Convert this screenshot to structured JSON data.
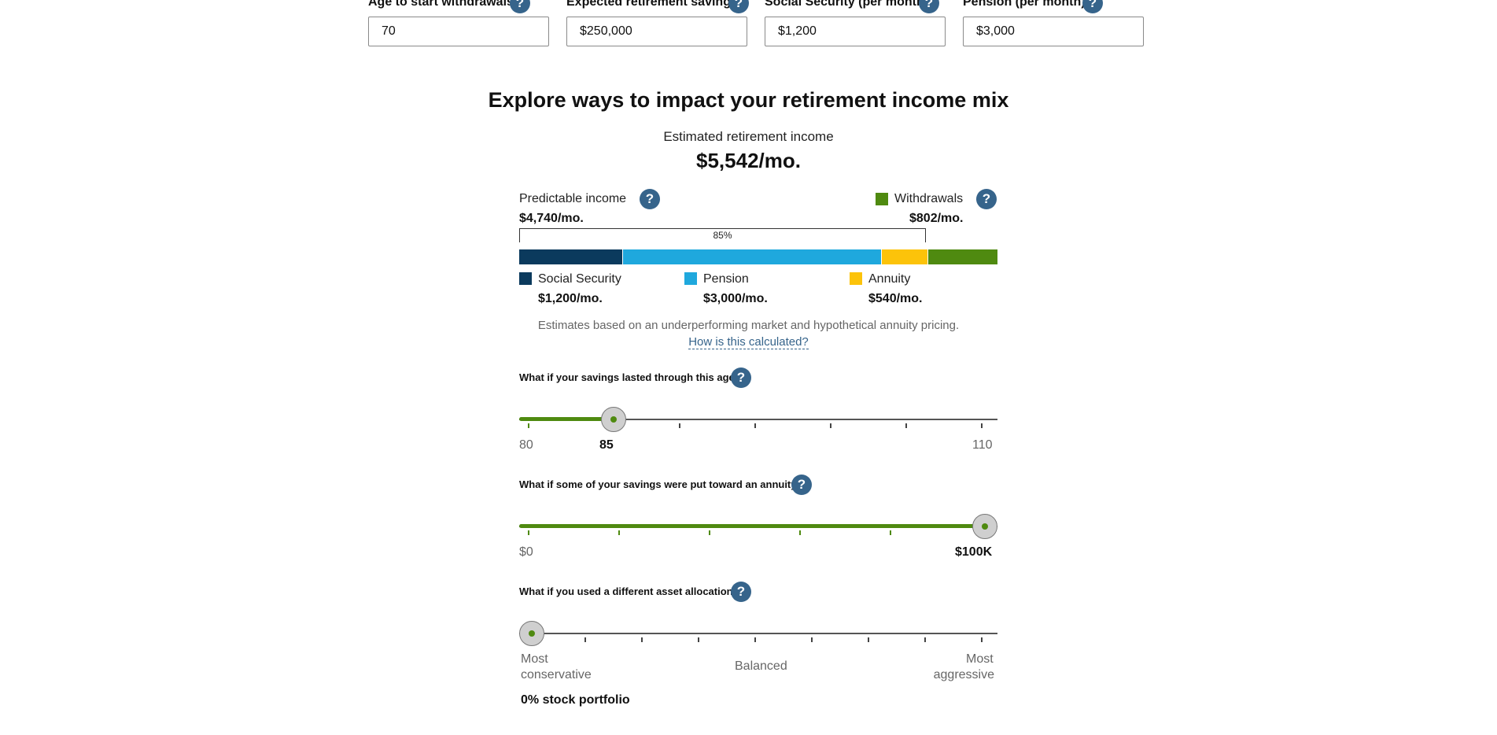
{
  "inputs": [
    {
      "label": "Age to start withdrawals",
      "value": "70"
    },
    {
      "label": "Expected retirement savings",
      "value": "$250,000"
    },
    {
      "label": "Social Security (per month)",
      "value": "$1,200"
    },
    {
      "label": "Pension (per month)",
      "value": "$3,000"
    }
  ],
  "help_glyph": "?",
  "heading": "Explore ways to impact your retirement income mix",
  "estimate": {
    "label": "Estimated retirement income",
    "value": "$5,542/mo."
  },
  "predictable": {
    "label": "Predictable income",
    "value": "$4,740/mo.",
    "percent": "85%"
  },
  "withdrawals": {
    "label": "Withdrawals",
    "value": "$802/mo.",
    "color": "#4f8a10"
  },
  "income_bar": {
    "segments": [
      {
        "name": "Social Security",
        "amount": 1200,
        "color": "#0b3a5d"
      },
      {
        "name": "Pension",
        "amount": 3000,
        "color": "#1fa8dd"
      },
      {
        "name": "Annuity",
        "amount": 540,
        "color": "#fcc30a"
      },
      {
        "name": "Withdrawals",
        "amount": 802,
        "color": "#4f8a10"
      }
    ]
  },
  "legend": [
    {
      "label": "Social Security",
      "value": "$1,200/mo.",
      "color": "#0b3a5d"
    },
    {
      "label": "Pension",
      "value": "$3,000/mo.",
      "color": "#1fa8dd"
    },
    {
      "label": "Annuity",
      "value": "$540/mo.",
      "color": "#fcc30a"
    }
  ],
  "disclaimer": "Estimates based on an underperforming market and hypothetical annuity pricing.",
  "calc_link": "How is this calculated?",
  "sliders": {
    "age": {
      "question": "What if your savings lasted through this age?",
      "min_label": "80",
      "value_label": "85",
      "max_label": "110",
      "fraction": 0.18
    },
    "annuity": {
      "question": "What if some of your savings were put toward an annuity?",
      "min_label": "$0",
      "value_label": "$100K",
      "fraction": 1.0
    },
    "allocation": {
      "question": "What if you used a different asset allocation?",
      "min_label_1": "Most",
      "min_label_2": "conservative",
      "mid_label": "Balanced",
      "max_label_1": "Most",
      "max_label_2": "aggressive",
      "fraction": 0.0,
      "result": "0% stock portfolio"
    }
  }
}
